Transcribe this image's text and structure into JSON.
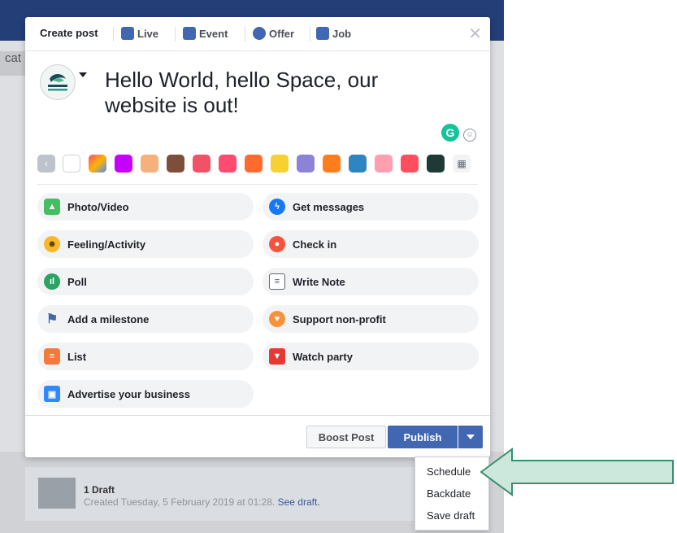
{
  "background": {
    "clipped_text": "cat",
    "draft": {
      "title": "1 Draft",
      "subtitle": "Created Tuesday, 5 February 2019 at 01:28.",
      "link": "See draft."
    }
  },
  "tabs": [
    {
      "label": "Create post",
      "icon": "pencil-icon",
      "color": "#1d2129"
    },
    {
      "label": "Live",
      "icon": "live-camera-icon",
      "color": "#4267b2"
    },
    {
      "label": "Event",
      "icon": "calendar-icon",
      "color": "#4267b2"
    },
    {
      "label": "Offer",
      "icon": "offer-tag-icon",
      "color": "#4267b2"
    },
    {
      "label": "Job",
      "icon": "briefcase-icon",
      "color": "#4267b2"
    }
  ],
  "composer": {
    "text": "Hello World, hello Space, our website is out!",
    "avatar_text_1": "OUR SPACE",
    "avatar_text_2": "OUR FUTURE"
  },
  "swatches": [
    {
      "name": "prev-arrow",
      "color": "#bec2c9"
    },
    {
      "name": "white",
      "color": "#ffffff"
    },
    {
      "name": "gradient-multicolor",
      "color": "#e7466b"
    },
    {
      "name": "purple",
      "color": "#c600ff"
    },
    {
      "name": "shell-pattern",
      "color": "#f5b17b"
    },
    {
      "name": "brown-emoji",
      "color": "#7d4e3b"
    },
    {
      "name": "red-heart",
      "color": "#f25268"
    },
    {
      "name": "heart-eyes",
      "color": "#ff4a72"
    },
    {
      "name": "fire",
      "color": "#ff6a2f"
    },
    {
      "name": "yellow-character",
      "color": "#f7d033"
    },
    {
      "name": "lavender",
      "color": "#8c83d8"
    },
    {
      "name": "orange-circle",
      "color": "#ff7d1a"
    },
    {
      "name": "blue-leaf",
      "color": "#2e86c1"
    },
    {
      "name": "pink-eye",
      "color": "#ff9fb0"
    },
    {
      "name": "red-pink",
      "color": "#ff4f5e"
    },
    {
      "name": "dark-green-plant",
      "color": "#1f3a34"
    },
    {
      "name": "grid-more",
      "color": "#f2f3f5"
    }
  ],
  "options": [
    {
      "label": "Photo/Video",
      "icon": "photo-icon",
      "color": "#45bd62"
    },
    {
      "label": "Get messages",
      "icon": "messenger-icon",
      "color": "#1877f2"
    },
    {
      "label": "Feeling/Activity",
      "icon": "smiley-icon",
      "color": "#f7b928"
    },
    {
      "label": "Check in",
      "icon": "location-pin-icon",
      "color": "#f5533d"
    },
    {
      "label": "Poll",
      "icon": "poll-icon",
      "color": "#2aa364"
    },
    {
      "label": "Write Note",
      "icon": "note-icon",
      "color": "#606770"
    },
    {
      "label": "Add a milestone",
      "icon": "flag-icon",
      "color": "#4267b2"
    },
    {
      "label": "Support non-profit",
      "icon": "heart-coin-icon",
      "color": "#f7923b"
    },
    {
      "label": "List",
      "icon": "list-icon",
      "color": "#f5793b"
    },
    {
      "label": "Watch party",
      "icon": "popcorn-icon",
      "color": "#e53935"
    },
    {
      "label": "Advertise your business",
      "icon": "advertise-icon",
      "color": "#2e89ff"
    }
  ],
  "footer": {
    "boost_label": "Boost Post",
    "publish_label": "Publish"
  },
  "dropdown": {
    "items": [
      "Schedule",
      "Backdate",
      "Save draft"
    ]
  },
  "colors": {
    "brand_blue": "#4267b2",
    "arrow_fill": "#cce8dc",
    "arrow_stroke": "#3a8f6c"
  }
}
